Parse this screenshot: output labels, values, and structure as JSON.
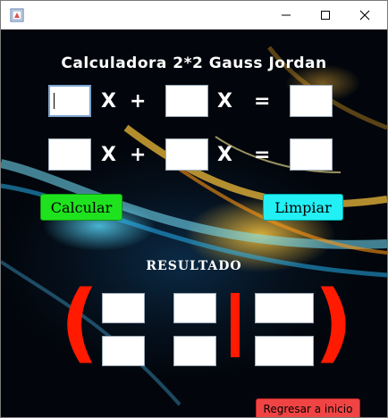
{
  "window": {
    "title": "",
    "controls": [
      "minimize-icon",
      "maximize-icon",
      "close-icon"
    ]
  },
  "header": {
    "title": "Calculadora 2*2 Gauss Jordan"
  },
  "equations": [
    {
      "a": "",
      "b": "",
      "c": ""
    },
    {
      "a": "",
      "b": "",
      "c": ""
    }
  ],
  "ops": {
    "x": "X",
    "plus": "+",
    "equals": "="
  },
  "buttons": {
    "calculate": "Calcular",
    "clear": "Limpiar",
    "back": "Regresar a inicio"
  },
  "result": {
    "label": "RESULTADO",
    "left_paren": "(",
    "right_paren": ")",
    "matrix": [
      [
        "",
        "",
        ""
      ],
      [
        "",
        "",
        ""
      ]
    ]
  },
  "colors": {
    "calculate_button": "#1fe21f",
    "clear_button": "#22f0f4",
    "back_button": "#f04444",
    "matrix_brackets": "#ff1a00"
  }
}
